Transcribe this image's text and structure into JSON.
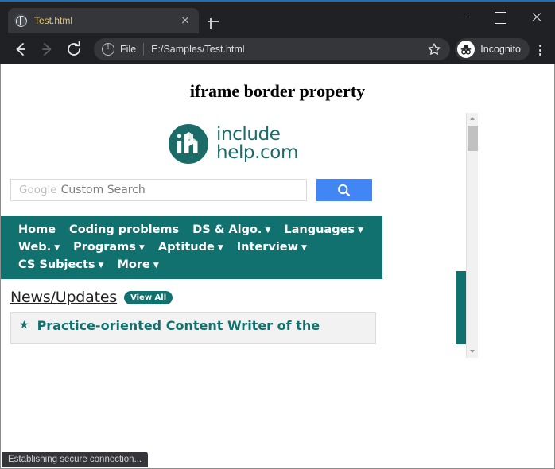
{
  "browser": {
    "tab": {
      "title": "Test.html",
      "favicon": "globe-icon",
      "close_label": "x",
      "new_tab_label": "+"
    },
    "window_controls": {
      "minimize": "minimize-icon",
      "maximize": "maximize-icon",
      "close": "close-icon"
    },
    "toolbar": {
      "back": "back-arrow-icon",
      "forward": "forward-arrow-icon",
      "reload": "reload-icon",
      "info": "info-circle-icon",
      "scheme": "File",
      "url": "E:/Samples/Test.html",
      "bookmark": "star-icon",
      "profile_label": "Incognito",
      "profile_avatar": "incognito-avatar-icon",
      "menu": "three-dot-menu-icon"
    },
    "status_text": "Establishing secure connection..."
  },
  "page": {
    "heading": "iframe border property"
  },
  "iframe": {
    "logo": {
      "mark": "ih-monogram-icon",
      "line1": "include",
      "line2": "help.com"
    },
    "search": {
      "brand": "Google",
      "placeholder": "Custom Search",
      "value": "",
      "button_icon": "search-icon"
    },
    "nav": {
      "rows": [
        [
          {
            "label": "Home",
            "caret": false
          },
          {
            "label": "Coding problems",
            "caret": false
          },
          {
            "label": "DS & Algo.",
            "caret": true
          },
          {
            "label": "Languages",
            "caret": true
          }
        ],
        [
          {
            "label": "Web.",
            "caret": true
          },
          {
            "label": "Programs",
            "caret": true
          },
          {
            "label": "Aptitude",
            "caret": true
          },
          {
            "label": "Interview",
            "caret": true
          }
        ],
        [
          {
            "label": "CS Subjects",
            "caret": true
          },
          {
            "label": "More",
            "caret": true
          }
        ]
      ],
      "caret_glyph": "▼"
    },
    "news": {
      "title": "News/Updates",
      "view_all": "View All",
      "items": [
        {
          "bullet": "★",
          "text": "Practice-oriented Content Writer of the"
        }
      ]
    },
    "scrollbar": {
      "up_arrow": "scroll-up-arrow-icon",
      "down_arrow": "scroll-down-arrow-icon",
      "thumb": "scrollbar-thumb"
    }
  },
  "colors": {
    "teal": "#11716e",
    "logo_teal": "#1b6b69",
    "google_blue": "#4285f4",
    "chrome_dark": "#202124",
    "chrome_tab": "#35363a",
    "tab_title": "#e3c87a"
  }
}
